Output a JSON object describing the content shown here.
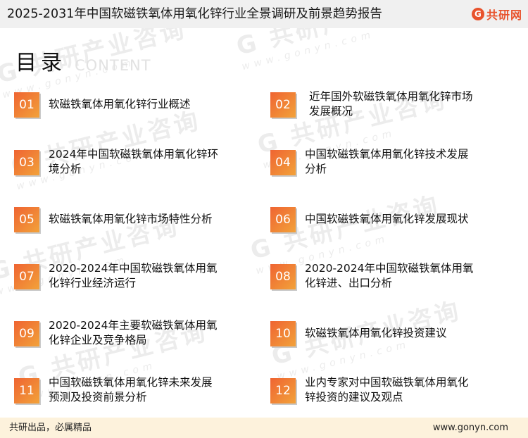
{
  "header": {
    "title": "2025-2031年中国软磁铁氧体用氧化锌行业全景调研及前景趋势报告",
    "brand_mark": "G",
    "brand_name": "共研网"
  },
  "watermark": {
    "text": "共研产业咨询",
    "url": "www.gonyn.com"
  },
  "toc": {
    "heading": "目录",
    "heading_en": "CONTENT",
    "items": [
      {
        "num": "01",
        "lines": [
          "软磁铁氧体用氧化锌行业概述"
        ]
      },
      {
        "num": "02",
        "lines": [
          "近年国外软磁铁氧体用氧化锌市场",
          "发展概况"
        ]
      },
      {
        "num": "03",
        "lines": [
          "2024年中国软磁铁氧体用氧化锌环",
          "境分析"
        ]
      },
      {
        "num": "04",
        "lines": [
          "中国软磁铁氧体用氧化锌技术发展",
          "分析"
        ]
      },
      {
        "num": "05",
        "lines": [
          "软磁铁氧体用氧化锌市场特性分析"
        ]
      },
      {
        "num": "06",
        "lines": [
          "中国软磁铁氧体用氧化锌发展现状"
        ]
      },
      {
        "num": "07",
        "lines": [
          "2020-2024年中国软磁铁氧体用氧",
          "化锌行业经济运行"
        ]
      },
      {
        "num": "08",
        "lines": [
          "2020-2024年中国软磁铁氧体用氧",
          "化锌进、出口分析"
        ]
      },
      {
        "num": "09",
        "lines": [
          "2020-2024年主要软磁铁氧体用氧",
          "化锌企业及竞争格局"
        ]
      },
      {
        "num": "10",
        "lines": [
          "软磁铁氧体用氧化锌投资建议"
        ]
      },
      {
        "num": "11",
        "lines": [
          "中国软磁铁氧体用氧化锌未来发展",
          "预测及投资前景分析"
        ]
      },
      {
        "num": "12",
        "lines": [
          "业内专家对中国软磁铁氧体用氧化",
          "锌投资的建议及观点"
        ]
      }
    ]
  },
  "footer": {
    "slogan": "共研出品，必属精品",
    "site": "www.gonyn.com"
  },
  "colors": {
    "accent": "#ef6432",
    "accent_light": "#f2a23a",
    "topbar": "#f0f0f0",
    "footer": "#fdf2dc"
  }
}
